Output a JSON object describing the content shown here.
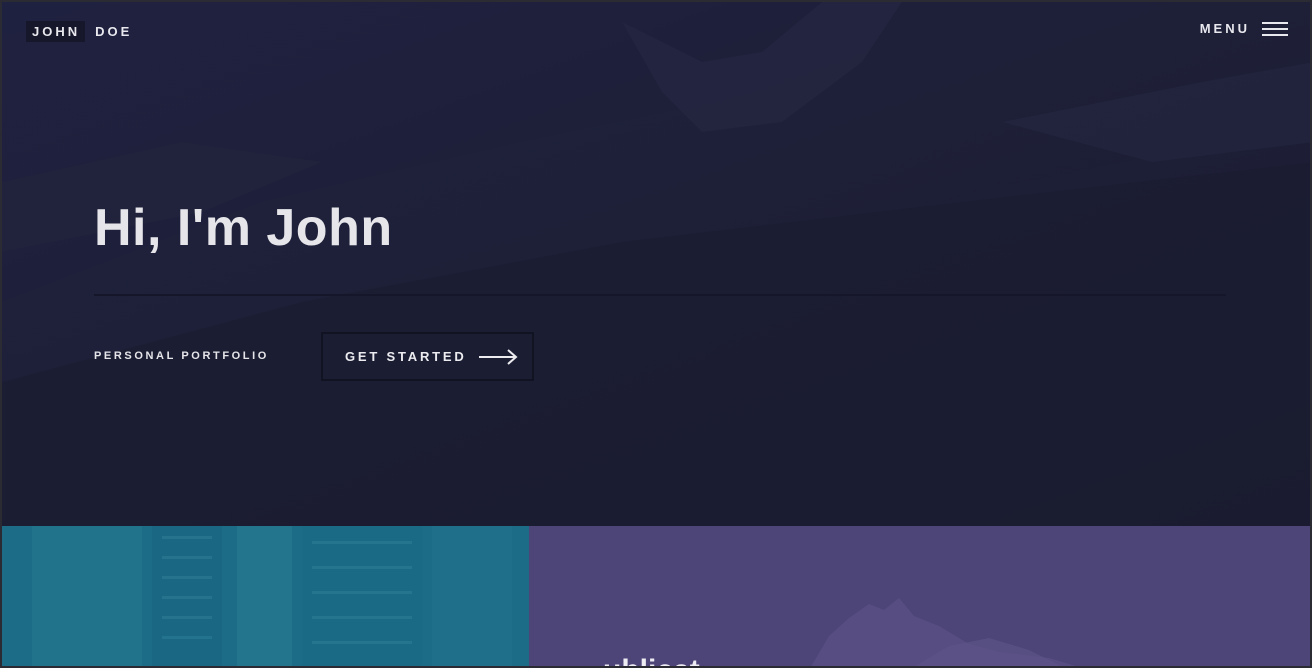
{
  "header": {
    "logo_first": "JOHN",
    "logo_last": "DOE",
    "menu_label": "MENU",
    "menu_icon": "hamburger-icon"
  },
  "hero": {
    "title": "Hi, I'm John",
    "subtitle": "PERSONAL PORTFOLIO",
    "cta_label": "GET STARTED",
    "cta_icon": "arrow-right-icon"
  },
  "panels": {
    "left_color": "#1d6c87",
    "right_color": "#4d4478",
    "right_title_partial": "ublicat"
  },
  "colors": {
    "hero_bg": "#1e2039",
    "text": "#e6e6ea"
  }
}
